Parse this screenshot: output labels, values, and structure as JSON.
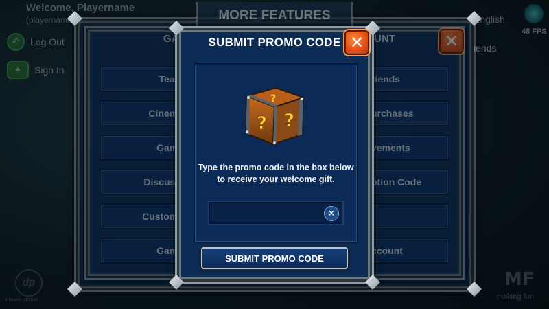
{
  "hud": {
    "welcome": "Welcome, Playername",
    "username": "(playername",
    "logout_label": "Log Out",
    "signin_label": "Sign In",
    "language": "English",
    "fps": "48 FPS",
    "logo_left_text": "dream primer",
    "logo_right_text": "making fun",
    "logo_right_mark": "MF"
  },
  "background_panel": {
    "title": "MORE FEATURES",
    "left_column_title": "GA",
    "right_column_title": "UNT",
    "right_close_icon": "close-icon",
    "left_items": [
      "Team",
      "Cinema",
      "Game",
      "Discussi",
      "Custome",
      "Game"
    ],
    "right_items": [
      "riends",
      "urchases",
      "vements",
      "otion Code",
      "",
      "ccount"
    ],
    "right_header_extra": "iends"
  },
  "modal": {
    "title": "SUBMIT PROMO CODE",
    "close_icon": "close-icon",
    "image": "mystery-crate",
    "message": "Type the promo code in the box below to receive your welcome gift.",
    "input_value": "",
    "input_placeholder": "",
    "clear_icon": "clear-icon",
    "submit_label": "SUBMIT PROMO CODE"
  },
  "colors": {
    "panel_blue": "#0e2f57",
    "button_blue": "#0f3566",
    "close_orange": "#e5531a",
    "frame_silver": "#8f9aa3"
  }
}
